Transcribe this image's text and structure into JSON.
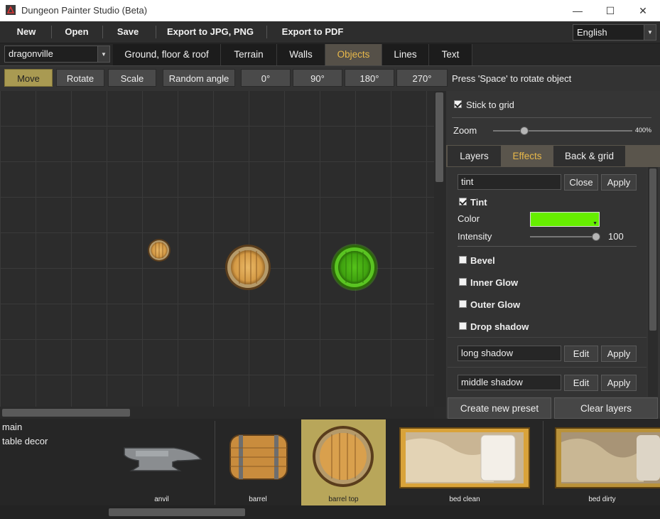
{
  "window": {
    "title": "Dungeon Painter Studio (Beta)",
    "controls": [
      "—",
      "☐",
      "✕"
    ]
  },
  "menu": {
    "items": [
      "New",
      "Open",
      "Save",
      "Export to JPG, PNG",
      "Export to PDF"
    ],
    "language": "English"
  },
  "map_select": "dragonville",
  "tabs": [
    {
      "label": "Ground, floor & roof",
      "active": false
    },
    {
      "label": "Terrain",
      "active": false
    },
    {
      "label": "Walls",
      "active": false
    },
    {
      "label": "Objects",
      "active": true
    },
    {
      "label": "Lines",
      "active": false
    },
    {
      "label": "Text",
      "active": false
    }
  ],
  "toolbar": {
    "buttons": [
      {
        "label": "Move",
        "active": true
      },
      {
        "label": "Rotate",
        "active": false
      },
      {
        "label": "Scale",
        "active": false
      },
      {
        "label": "Random angle",
        "active": false
      },
      {
        "label": "0°",
        "active": false
      },
      {
        "label": "90°",
        "active": false
      },
      {
        "label": "180°",
        "active": false
      },
      {
        "label": "270°",
        "active": false
      }
    ],
    "hint": "Press 'Space' to rotate object"
  },
  "right_panel": {
    "stick_to_grid": {
      "label": "Stick to grid",
      "checked": true
    },
    "zoom": {
      "label": "Zoom",
      "value": "400%",
      "level": 0.22
    },
    "tabs": [
      {
        "label": "Layers",
        "active": false
      },
      {
        "label": "Effects",
        "active": true
      },
      {
        "label": "Back & grid",
        "active": false
      }
    ],
    "preset": {
      "value": "tint",
      "close": "Close",
      "apply": "Apply"
    },
    "tint": {
      "label": "Tint",
      "checked": true,
      "color_label": "Color",
      "color": "#66ee00",
      "intensity_label": "Intensity",
      "intensity": "100"
    },
    "effects": [
      {
        "label": "Bevel",
        "checked": false
      },
      {
        "label": "Inner Glow",
        "checked": false
      },
      {
        "label": "Outer Glow",
        "checked": false
      },
      {
        "label": "Drop shadow",
        "checked": false
      }
    ],
    "presets": [
      {
        "name": "long shadow",
        "edit": "Edit",
        "apply": "Apply"
      },
      {
        "name": "middle shadow",
        "edit": "Edit",
        "apply": "Apply"
      }
    ],
    "create_preset": "Create new preset",
    "clear_layers": "Clear layers"
  },
  "library": {
    "categories": [
      "main",
      "table decor"
    ],
    "assets": [
      {
        "name": "anvil",
        "selected": false
      },
      {
        "name": "barrel",
        "selected": false
      },
      {
        "name": "barrel top",
        "selected": true
      },
      {
        "name": "bed clean",
        "selected": false
      },
      {
        "name": "bed dirty",
        "selected": false
      }
    ]
  },
  "colors": {
    "accent": "#e8b84a",
    "active_button": "#a99a52",
    "tint": "#66ee00"
  }
}
